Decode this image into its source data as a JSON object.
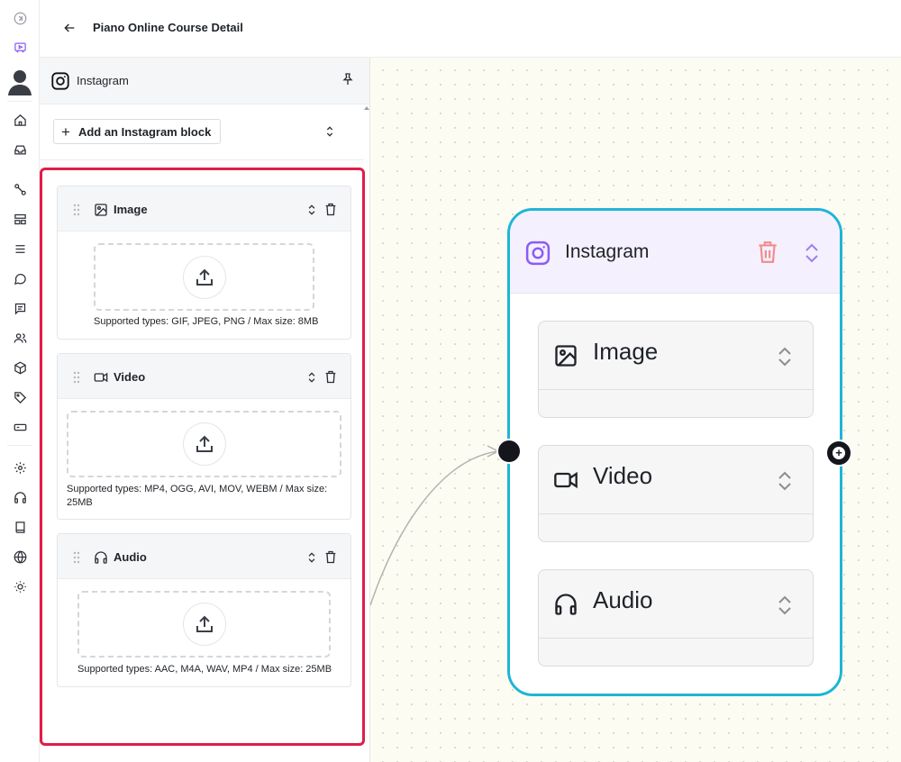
{
  "header": {
    "title": "Piano Online Course Detail"
  },
  "rail": {
    "items": [
      "collapse-icon",
      "broadcast-icon",
      "avatar",
      "home-icon",
      "inbox-icon",
      "workflow-icon",
      "layout-icon",
      "menu-icon",
      "chat-icon",
      "message-icon",
      "users-icon",
      "box-icon",
      "tag-icon",
      "card-icon",
      "settings-icon",
      "headphones-icon",
      "book-icon",
      "globe-icon",
      "sun-icon"
    ]
  },
  "panel": {
    "title": "Instagram",
    "add_label": "Add an Instagram block",
    "blocks": [
      {
        "title": "Image",
        "supported": "Supported types: GIF, JPEG, PNG / Max size: 8MB"
      },
      {
        "title": "Video",
        "supported": "Supported types: MP4, OGG, AVI, MOV, WEBM / Max size: 25MB"
      },
      {
        "title": "Audio",
        "supported": "Supported types: AAC, M4A, WAV, MP4 / Max size: 25MB"
      }
    ]
  },
  "node": {
    "title": "Instagram",
    "items": [
      "Image",
      "Video",
      "Audio"
    ]
  },
  "colors": {
    "highlight": "#e11d48",
    "node_border": "#1fb5d6",
    "accent": "#8b5cf6",
    "delete": "#f28b8b"
  }
}
